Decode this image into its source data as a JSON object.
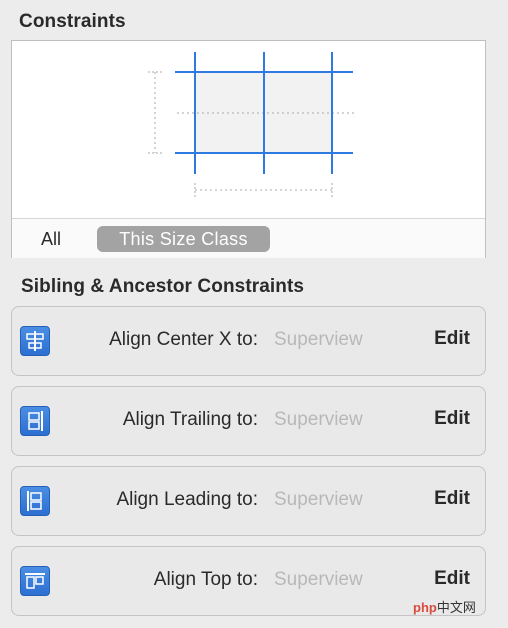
{
  "titles": {
    "constraints": "Constraints",
    "sibling": "Sibling & Ancestor Constraints"
  },
  "size_class": {
    "all": "All",
    "this": "This Size Class"
  },
  "rows": [
    {
      "label": "Align Center X to:",
      "value": "Superview",
      "edit": "Edit",
      "icon": "align-center-x-icon"
    },
    {
      "label": "Align Trailing to:",
      "value": "Superview",
      "edit": "Edit",
      "icon": "align-trailing-icon"
    },
    {
      "label": "Align Leading to:",
      "value": "Superview",
      "edit": "Edit",
      "icon": "align-leading-icon"
    },
    {
      "label": "Align Top to:",
      "value": "Superview",
      "edit": "Edit",
      "icon": "align-top-icon"
    }
  ],
  "watermark": {
    "brand": "php",
    "site": "中文网"
  },
  "colors": {
    "accent": "#2f7ae0",
    "muted_text": "#b8b8b8"
  }
}
